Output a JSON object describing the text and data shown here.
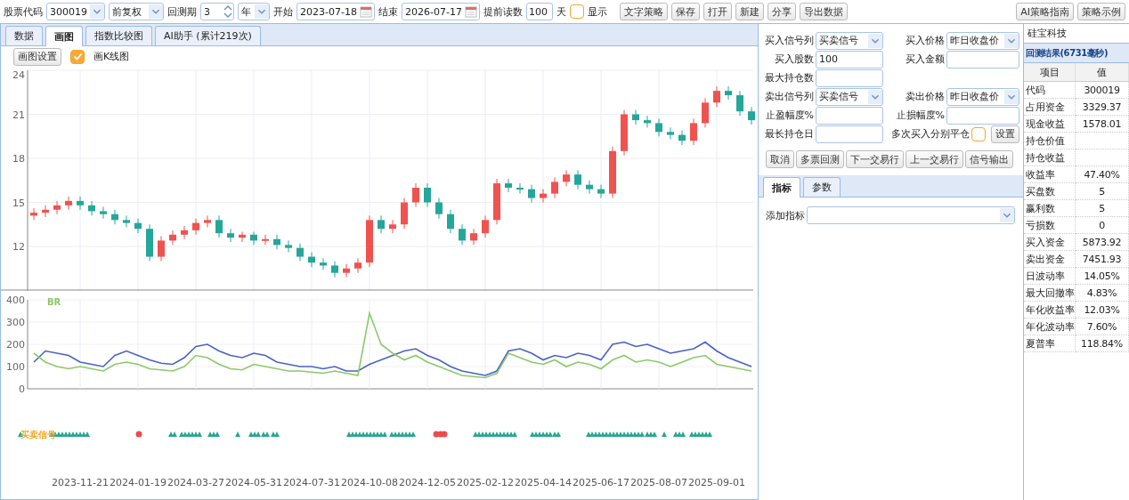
{
  "toolbar": {
    "code": {
      "label": "股票代码",
      "value": "300019"
    },
    "adjust": {
      "value": "前复权"
    },
    "period": {
      "label": "回测期",
      "value": "3",
      "unit": "年"
    },
    "start": {
      "label": "开始",
      "value": "2023-07-18"
    },
    "end": {
      "label": "结束",
      "value": "2026-07-17"
    },
    "preload": {
      "label": "提前读数",
      "value": "100",
      "unit": "天"
    },
    "show": {
      "label": "显示",
      "checked": false
    },
    "buttons": [
      "文字策略",
      "保存",
      "打开",
      "新建",
      "分享",
      "导出数据"
    ],
    "right_buttons": [
      "AI策略指南",
      "策略示例"
    ]
  },
  "tabs": [
    {
      "label": "数据",
      "selected": false
    },
    {
      "label": "画图",
      "selected": true
    },
    {
      "label": "指数比较图",
      "selected": false
    },
    {
      "label": "AI助手 (累计219次)",
      "selected": false
    }
  ],
  "chart_toolbar": {
    "button": "画图设置",
    "kline": {
      "label": "画K线图",
      "checked": true
    }
  },
  "kline_chart": {
    "chart_data": {
      "type": "candlestick",
      "grid": true,
      "ylim": [
        9,
        24
      ],
      "yticks": [
        12,
        15,
        18,
        21,
        24
      ],
      "ohlc": [
        [
          14.1,
          14.6,
          13.8,
          14.3
        ],
        [
          14.3,
          14.8,
          14.0,
          14.5
        ],
        [
          14.5,
          15.1,
          14.2,
          14.8
        ],
        [
          14.8,
          15.4,
          14.5,
          15.1
        ],
        [
          15.1,
          15.4,
          14.5,
          14.8
        ],
        [
          14.8,
          15.1,
          14.1,
          14.4
        ],
        [
          14.4,
          14.7,
          13.9,
          14.2
        ],
        [
          14.2,
          14.5,
          13.5,
          13.8
        ],
        [
          13.8,
          14.1,
          13.3,
          13.6
        ],
        [
          13.6,
          13.9,
          12.9,
          13.2
        ],
        [
          13.2,
          13.5,
          11.0,
          11.3
        ],
        [
          11.3,
          12.7,
          11.0,
          12.4
        ],
        [
          12.4,
          13.1,
          12.1,
          12.8
        ],
        [
          12.8,
          13.4,
          12.5,
          13.1
        ],
        [
          13.1,
          13.9,
          12.8,
          13.6
        ],
        [
          13.6,
          14.1,
          13.3,
          13.8
        ],
        [
          13.8,
          14.1,
          12.6,
          12.9
        ],
        [
          12.9,
          13.2,
          12.3,
          12.6
        ],
        [
          12.6,
          13.0,
          12.3,
          12.8
        ],
        [
          12.8,
          13.0,
          12.1,
          12.4
        ],
        [
          12.4,
          12.8,
          12.1,
          12.5
        ],
        [
          12.5,
          12.8,
          11.8,
          12.1
        ],
        [
          12.1,
          12.4,
          11.6,
          11.9
        ],
        [
          11.9,
          12.2,
          11.0,
          11.3
        ],
        [
          11.3,
          11.6,
          10.6,
          10.9
        ],
        [
          10.9,
          11.2,
          10.4,
          10.7
        ],
        [
          10.7,
          11.0,
          9.9,
          10.2
        ],
        [
          10.2,
          10.8,
          9.9,
          10.5
        ],
        [
          10.5,
          11.2,
          10.2,
          10.9
        ],
        [
          10.9,
          14.1,
          10.6,
          13.8
        ],
        [
          13.8,
          14.1,
          12.9,
          13.2
        ],
        [
          13.2,
          13.8,
          12.9,
          13.5
        ],
        [
          13.5,
          15.3,
          13.2,
          15.0
        ],
        [
          15.0,
          16.3,
          14.7,
          16.0
        ],
        [
          16.0,
          16.3,
          14.7,
          15.0
        ],
        [
          15.0,
          15.3,
          13.9,
          14.2
        ],
        [
          14.2,
          14.5,
          12.9,
          13.2
        ],
        [
          13.2,
          13.5,
          12.1,
          12.4
        ],
        [
          12.4,
          13.2,
          12.1,
          12.9
        ],
        [
          12.9,
          14.1,
          12.6,
          13.8
        ],
        [
          13.8,
          16.6,
          13.5,
          16.3
        ],
        [
          16.3,
          16.6,
          15.7,
          16.0
        ],
        [
          16.0,
          16.3,
          15.6,
          15.9
        ],
        [
          15.9,
          16.2,
          15.0,
          15.3
        ],
        [
          15.3,
          15.9,
          15.0,
          15.6
        ],
        [
          15.6,
          16.7,
          15.3,
          16.4
        ],
        [
          16.4,
          17.2,
          16.1,
          16.9
        ],
        [
          16.9,
          17.2,
          15.9,
          16.2
        ],
        [
          16.2,
          16.5,
          15.6,
          15.9
        ],
        [
          15.9,
          16.2,
          15.3,
          15.6
        ],
        [
          15.6,
          18.8,
          15.3,
          18.5
        ],
        [
          18.5,
          21.3,
          18.2,
          21.0
        ],
        [
          21.0,
          21.3,
          20.3,
          20.6
        ],
        [
          20.6,
          20.9,
          20.1,
          20.4
        ],
        [
          20.4,
          20.7,
          19.5,
          19.8
        ],
        [
          19.8,
          20.1,
          19.3,
          19.6
        ],
        [
          19.6,
          19.9,
          18.9,
          19.2
        ],
        [
          19.2,
          20.7,
          18.9,
          20.4
        ],
        [
          20.4,
          22.1,
          20.1,
          21.8
        ],
        [
          21.8,
          22.9,
          21.5,
          22.6
        ],
        [
          22.6,
          22.9,
          22.0,
          22.3
        ],
        [
          22.3,
          22.6,
          20.9,
          21.2
        ],
        [
          21.2,
          21.5,
          20.3,
          20.6
        ]
      ]
    }
  },
  "indicator_chart": {
    "chart_data": {
      "type": "line",
      "grid": true,
      "ylim": [
        0,
        400
      ],
      "yticks": [
        0,
        100,
        200,
        300,
        400
      ],
      "series": [
        {
          "color": "#4a62c8",
          "values": [
            120,
            170,
            160,
            150,
            120,
            110,
            100,
            150,
            170,
            150,
            130,
            115,
            110,
            140,
            190,
            200,
            170,
            150,
            140,
            160,
            150,
            120,
            110,
            100,
            100,
            90,
            100,
            80,
            80,
            110,
            130,
            150,
            170,
            180,
            150,
            130,
            100,
            80,
            70,
            60,
            80,
            170,
            180,
            160,
            130,
            150,
            140,
            160,
            150,
            130,
            200,
            210,
            190,
            200,
            180,
            160,
            170,
            180,
            210,
            170,
            140,
            120,
            100
          ]
        },
        {
          "name": "BR",
          "color": "#8cc96b",
          "values": [
            160,
            120,
            100,
            90,
            100,
            90,
            80,
            110,
            120,
            110,
            90,
            85,
            80,
            100,
            150,
            140,
            110,
            90,
            85,
            110,
            100,
            90,
            80,
            80,
            75,
            70,
            80,
            70,
            60,
            340,
            200,
            160,
            130,
            150,
            120,
            100,
            80,
            60,
            55,
            50,
            70,
            160,
            140,
            120,
            110,
            130,
            100,
            120,
            110,
            90,
            130,
            150,
            120,
            130,
            120,
            100,
            120,
            140,
            150,
            110,
            100,
            90,
            80
          ]
        }
      ]
    }
  },
  "signals": {
    "label": "买卖信号"
  },
  "date_labels": [
    "2023-11-21",
    "2024-01-19",
    "2024-03-27",
    "2024-05-31",
    "2024-07-31",
    "2024-10-08",
    "2024-12-05",
    "2025-02-12",
    "2025-04-14",
    "2025-06-17",
    "2025-08-07",
    "2025-09-01"
  ],
  "strategy_form": {
    "rows": [
      {
        "cells": [
          {
            "kind": "select",
            "label": "买入信号列",
            "value": "买卖信号"
          },
          {
            "kind": "select",
            "label": "买入价格",
            "value": "昨日收盘价"
          }
        ]
      },
      {
        "cells": [
          {
            "kind": "input",
            "label": "买入股数",
            "value": "100"
          },
          {
            "kind": "input",
            "label": "买入金额"
          }
        ]
      },
      {
        "cells": [
          {
            "kind": "input",
            "label": "最大持仓数"
          }
        ]
      },
      {
        "cells": [
          {
            "kind": "select",
            "label": "卖出信号列",
            "value": "买卖信号"
          },
          {
            "kind": "select",
            "label": "卖出价格",
            "value": "昨日收盘价"
          }
        ]
      },
      {
        "cells": [
          {
            "kind": "input",
            "label": "止盈幅度%"
          },
          {
            "kind": "input",
            "label": "止损幅度%"
          }
        ]
      },
      {
        "cells": [
          {
            "kind": "input",
            "label": "最长持仓日"
          },
          {
            "kind": "checkbox",
            "label": "多次买入分别平仓",
            "checked": false,
            "button": "设置"
          }
        ]
      }
    ],
    "actions": [
      "取消",
      "多票回测",
      "下一交易行",
      "上一交易行",
      "信号输出"
    ]
  },
  "sub_tabs": [
    {
      "label": "指标",
      "selected": true
    },
    {
      "label": "参数",
      "selected": false
    }
  ],
  "add_indicator": {
    "label": "添加指标"
  },
  "stock_name": "硅宝科技",
  "results": {
    "title": "回测结果(6731毫秒)",
    "columns": [
      "项目",
      "值"
    ],
    "rows": [
      {
        "item": "代码",
        "value": "300019"
      },
      {
        "item": "占用资金",
        "value": "3329.37"
      },
      {
        "item": "现金收益",
        "value": "1578.01"
      },
      {
        "item": "持仓价值"
      },
      {
        "item": "持仓收益"
      },
      {
        "item": "收益率",
        "value": "47.40%"
      },
      {
        "item": "买盘数",
        "value": "5"
      },
      {
        "item": "赢利数",
        "value": "5"
      },
      {
        "item": "亏损数",
        "value": "0"
      },
      {
        "item": "买入资金",
        "value": "5873.92"
      },
      {
        "item": "卖出资金",
        "value": "7451.93"
      },
      {
        "item": "日波动率",
        "value": "14.05%"
      },
      {
        "item": "最大回撤率",
        "value": "4.83%"
      },
      {
        "item": "年化收益率",
        "value": "12.03%"
      },
      {
        "item": "年化波动率",
        "value": "7.60%"
      },
      {
        "item": "夏普率",
        "value": "118.84%"
      }
    ]
  }
}
